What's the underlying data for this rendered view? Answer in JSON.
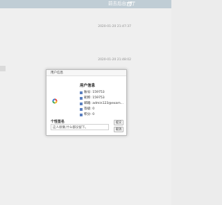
{
  "topbar": {
    "link_label": "前去后台大厅",
    "link_icon": "external-link-icon",
    "bg_color": "#b3c3cc"
  },
  "feed": {
    "timestamps": [
      "2020-01-20 21:47:37",
      "2020-01-20 21:48:02"
    ]
  },
  "modal": {
    "title": "用户信息",
    "close_glyph": "×",
    "info_heading": "用户信息",
    "fields": [
      "账号: 159753",
      "昵称: 159753",
      "邮箱: admin123@exam...",
      "等级: 0",
      "积分: 0"
    ],
    "signature_label": "个性签名",
    "signature_value": "这人很懒,什么都没留下。",
    "confirm_label": "提交",
    "cancel_label": "取消",
    "accent_color": "#5b80c0"
  }
}
